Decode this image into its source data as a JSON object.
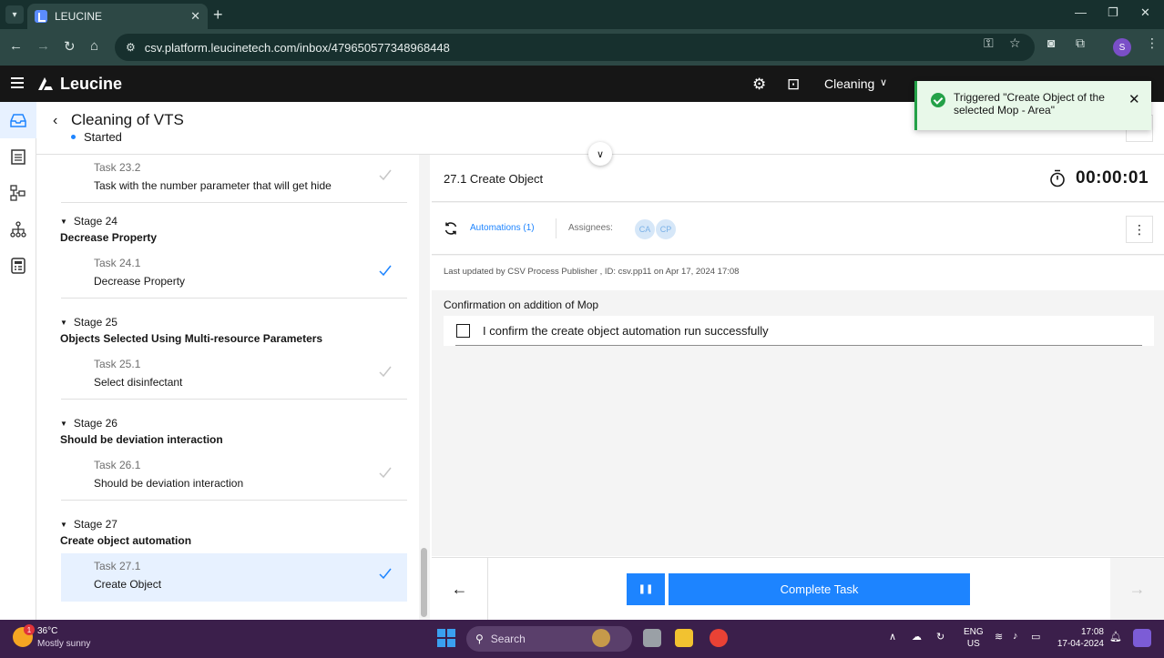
{
  "browser": {
    "tab_title": "LEUCINE",
    "url": "csv.platform.leucinetech.com/inbox/479650577348968448",
    "profile_initial": "S"
  },
  "app": {
    "logo_text": "Leucine",
    "facility": "Cleaning"
  },
  "toast": {
    "message": "Triggered \"Create Object of the selected Mop - Area\""
  },
  "job": {
    "title": "Cleaning of VTS",
    "status": "Started"
  },
  "stages": [
    {
      "name": "",
      "description": "",
      "tasks": [
        {
          "number": "Task 23.2",
          "name": "Task with the number parameter that will get hide",
          "completed": true,
          "active": false,
          "check_color": "#c6c6c6"
        }
      ]
    },
    {
      "name": "Stage 24",
      "description": "Decrease Property",
      "tasks": [
        {
          "number": "Task 24.1",
          "name": "Decrease Property",
          "completed": true,
          "active": false,
          "check_color": "#1d84ff"
        }
      ]
    },
    {
      "name": "Stage 25",
      "description": "Objects Selected Using Multi-resource Parameters",
      "tasks": [
        {
          "number": "Task 25.1",
          "name": "Select disinfectant",
          "completed": true,
          "active": false,
          "check_color": "#c6c6c6"
        }
      ]
    },
    {
      "name": "Stage 26",
      "description": "Should be deviation interaction",
      "tasks": [
        {
          "number": "Task 26.1",
          "name": "Should be deviation interaction",
          "completed": true,
          "active": false,
          "check_color": "#c6c6c6"
        }
      ]
    },
    {
      "name": "Stage 27",
      "description": "Create object automation",
      "tasks": [
        {
          "number": "Task 27.1",
          "name": "Create Object",
          "completed": true,
          "active": true,
          "check_color": "#1d84ff"
        }
      ]
    }
  ],
  "task_panel": {
    "title": "27.1 Create Object",
    "timer": "00:00:01",
    "automations_label": "Automations (1)",
    "assignees_label": "Assignees:",
    "assignees": [
      "CA",
      "CP"
    ],
    "last_updated": "Last updated by CSV Process Publisher , ID: csv.pp11 on Apr 17, 2024 17:08",
    "instruction_label": "Confirmation on addition of Mop",
    "checkbox_label": "I confirm the create object automation run successfully",
    "checkbox_checked": false
  },
  "footer": {
    "complete_label": "Complete Task"
  },
  "taskbar": {
    "weather_temp": "36°C",
    "weather_desc": "Mostly sunny",
    "weather_badge": "1",
    "search_placeholder": "Search",
    "lang_line1": "ENG",
    "lang_line2": "US",
    "time": "17:08",
    "date": "17-04-2024"
  },
  "colors": {
    "primary": "#1d84ff",
    "header_bg": "#161616",
    "success": "#24a148",
    "active_row": "#e7f1ff"
  }
}
